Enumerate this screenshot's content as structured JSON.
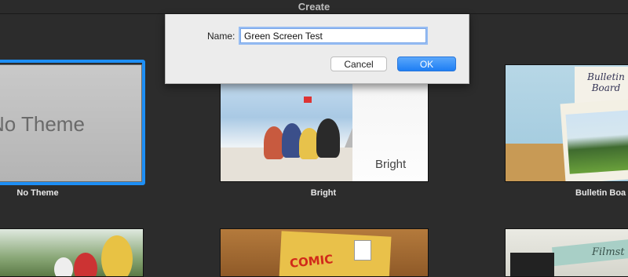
{
  "window": {
    "title": "Create"
  },
  "dialog": {
    "name_label": "Name:",
    "name_value": "Green Screen Test",
    "cancel_label": "Cancel",
    "ok_label": "OK"
  },
  "themes": [
    {
      "label": "No Theme",
      "thumb_text": "No Theme",
      "selected": true
    },
    {
      "label": "Bright",
      "thumb_text": "Bright"
    },
    {
      "label": "Bulletin Boa",
      "thumb_text": "Bulletin Board"
    }
  ],
  "bottom_row": [
    {
      "thumb_text": ""
    },
    {
      "thumb_text": "COMIC"
    },
    {
      "thumb_text": "Filmst"
    }
  ],
  "accent": {
    "selection": "#1e8ff5",
    "ok_button": "#1e7ef4"
  }
}
